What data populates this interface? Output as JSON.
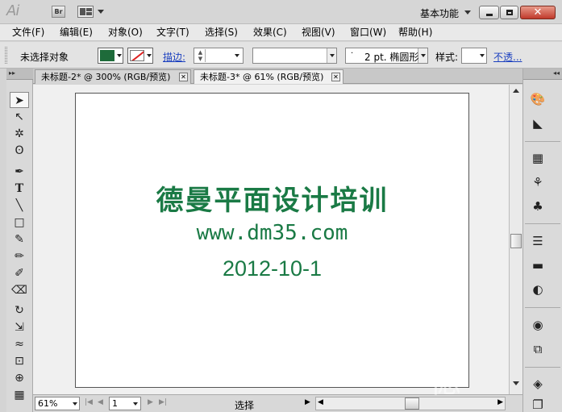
{
  "app": {
    "logo": "Ai",
    "bridge": "Br",
    "workspace": "基本功能"
  },
  "menu": [
    "文件(F)",
    "编辑(E)",
    "对象(O)",
    "文字(T)",
    "选择(S)",
    "效果(C)",
    "视图(V)",
    "窗口(W)",
    "帮助(H)"
  ],
  "control": {
    "selection": "未选择对象",
    "fill_color": "#1e6b3a",
    "stroke_label": "描边:",
    "brush": "2 pt. 椭圆形",
    "style_label": "样式:",
    "opacity_label": "不透..."
  },
  "tabs": [
    {
      "label": "未标题-2* @ 300% (RGB/预览)",
      "active": false
    },
    {
      "label": "未标题-3* @ 61% (RGB/预览)",
      "active": true
    }
  ],
  "artboard": {
    "title": "德曼平面设计培训",
    "url": "www.dm35.com",
    "date": "2012-10-1",
    "text_color": "#1a7a45"
  },
  "status": {
    "zoom": "61%",
    "page": "1",
    "tool": "选择"
  }
}
